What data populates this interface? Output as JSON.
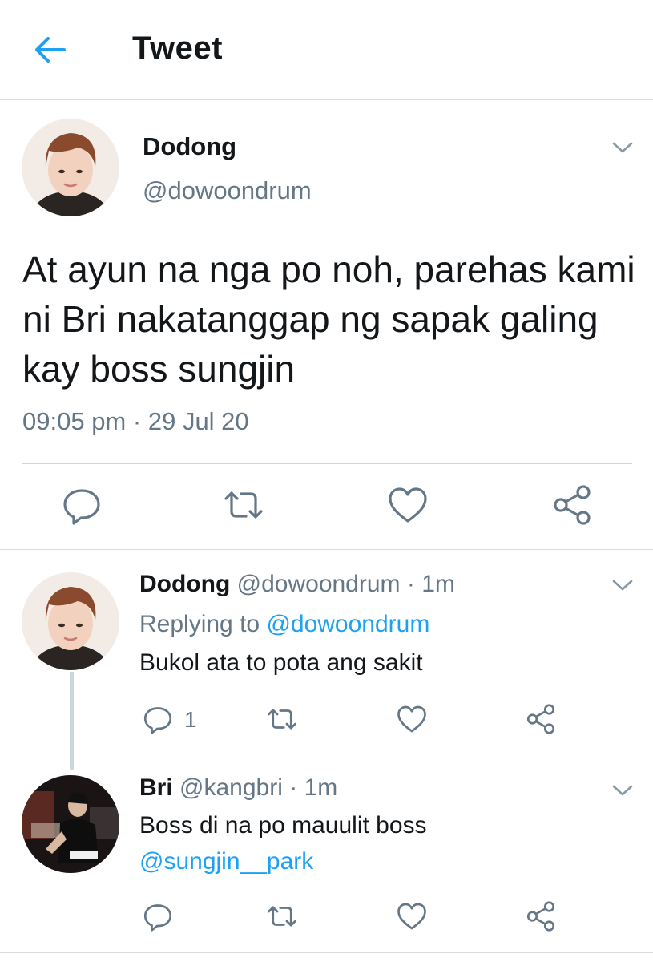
{
  "header": {
    "title": "Tweet"
  },
  "main_tweet": {
    "name": "Dodong",
    "handle": "@dowoondrum",
    "text": "At ayun na nga po noh, parehas kami ni Bri nakatanggap ng sapak galing kay boss sungjin",
    "time": "09:05 pm",
    "separator": "·",
    "date": "29 Jul 20"
  },
  "replies": [
    {
      "name": "Dodong",
      "handle": "@dowoondrum",
      "sep": "·",
      "age": "1m",
      "replying_label": "Replying to",
      "replying_to": "@dowoondrum",
      "text": "Bukol ata to pota ang sakit",
      "reply_count": "1"
    },
    {
      "name": "Bri",
      "handle": "@kangbri",
      "sep": "·",
      "age": "1m",
      "text": "Boss di na po mauulit boss",
      "mention": "@sungjin__park"
    }
  ],
  "colors": {
    "accent": "#1da1f2",
    "muted": "#657786",
    "text": "#14171a",
    "icon": "#657786"
  },
  "icons": [
    "back-arrow-icon",
    "chevron-down-icon",
    "reply-icon",
    "retweet-icon",
    "like-icon",
    "share-icon"
  ]
}
